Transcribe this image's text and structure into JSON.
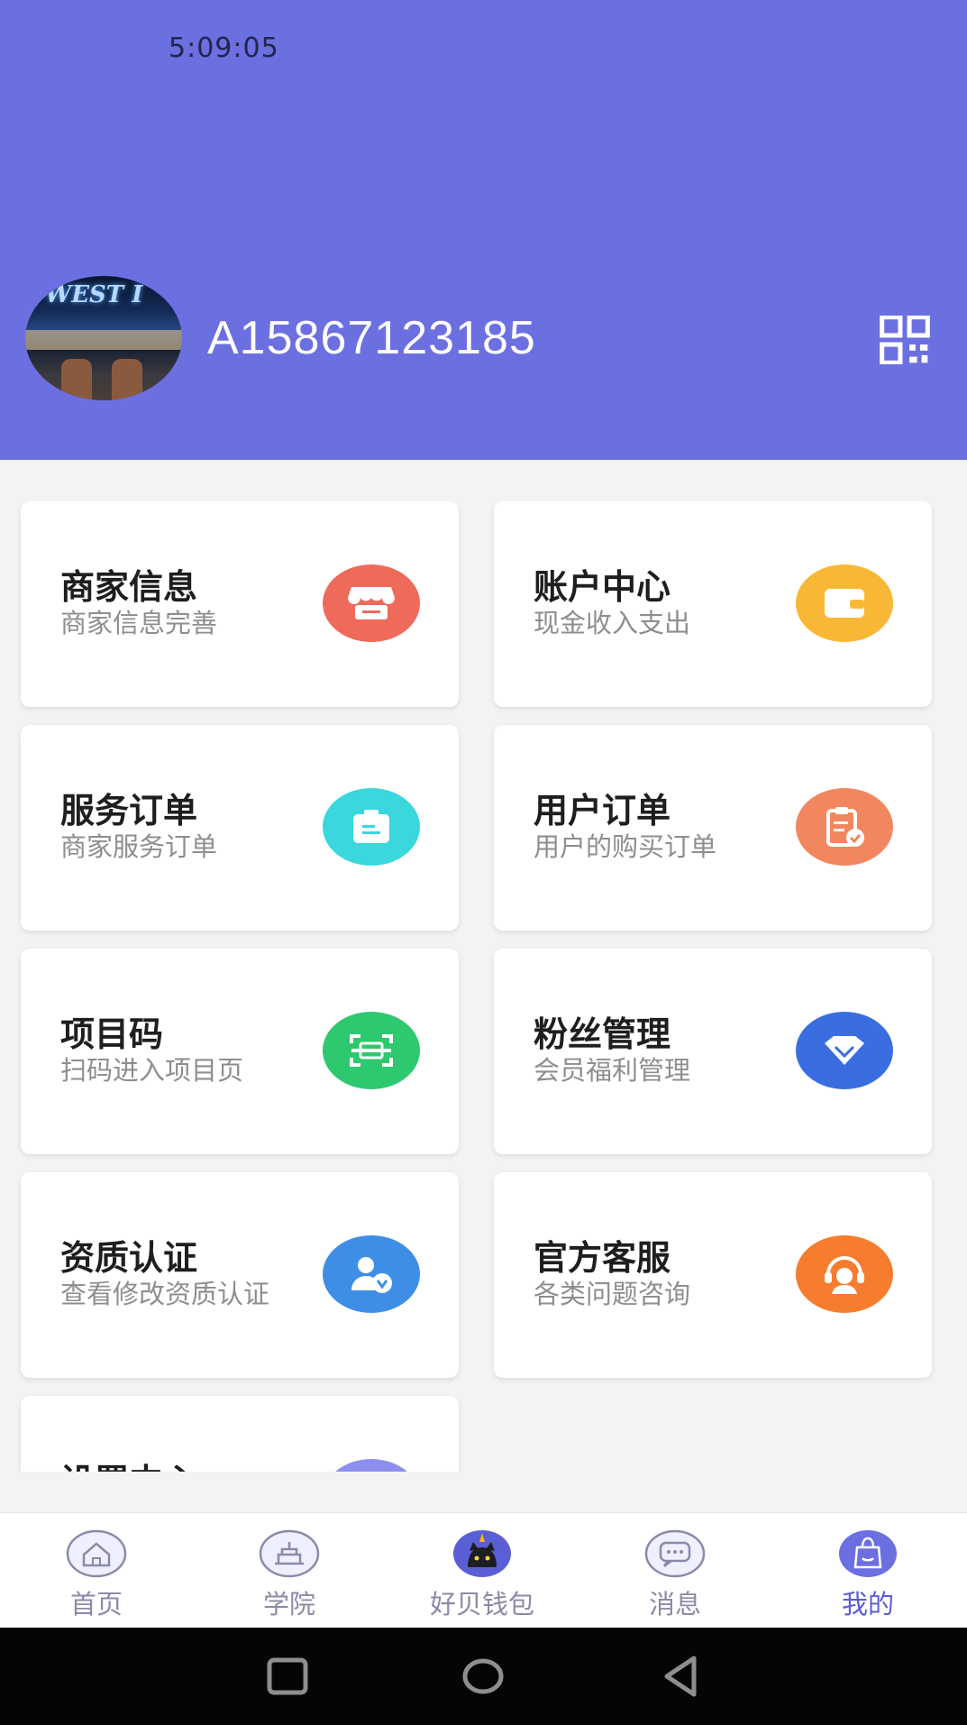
{
  "status": {
    "time": "5:09:05"
  },
  "profile": {
    "username": "A15867123185",
    "avatar_sign_text": "WEST I"
  },
  "menu": [
    {
      "title": "商家信息",
      "subtitle": "商家信息完善",
      "icon": "store-icon",
      "color": "#ee6a5b"
    },
    {
      "title": "账户中心",
      "subtitle": "现金收入支出",
      "icon": "wallet-icon",
      "color": "#f8b836"
    },
    {
      "title": "服务订单",
      "subtitle": "商家服务订单",
      "icon": "briefcase-icon",
      "color": "#3ad7dc"
    },
    {
      "title": "用户订单",
      "subtitle": "用户的购买订单",
      "icon": "order-check-icon",
      "color": "#f2875f"
    },
    {
      "title": "项目码",
      "subtitle": "扫码进入项目页",
      "icon": "scan-icon",
      "color": "#2ec86e"
    },
    {
      "title": "粉丝管理",
      "subtitle": "会员福利管理",
      "icon": "diamond-icon",
      "color": "#3a6ee0"
    },
    {
      "title": "资质认证",
      "subtitle": "查看修改资质认证",
      "icon": "user-verify-icon",
      "color": "#3f8ee6"
    },
    {
      "title": "官方客服",
      "subtitle": "各类问题咨询",
      "icon": "headset-icon",
      "color": "#f67c2e"
    },
    {
      "title": "设置中心",
      "subtitle": "",
      "icon": "settings-icon",
      "color": "#8c8ff0"
    }
  ],
  "tabs": [
    {
      "label": "首页",
      "icon": "home-icon"
    },
    {
      "label": "学院",
      "icon": "school-icon"
    },
    {
      "label": "好贝钱包",
      "icon": "cat-wallet-icon"
    },
    {
      "label": "消息",
      "icon": "message-icon"
    },
    {
      "label": "我的",
      "icon": "bag-icon",
      "active": true
    }
  ],
  "colors": {
    "header": "#6c6fe0",
    "tab_active": "#5a5cd8",
    "tab_inactive": "#8a8aa8"
  }
}
